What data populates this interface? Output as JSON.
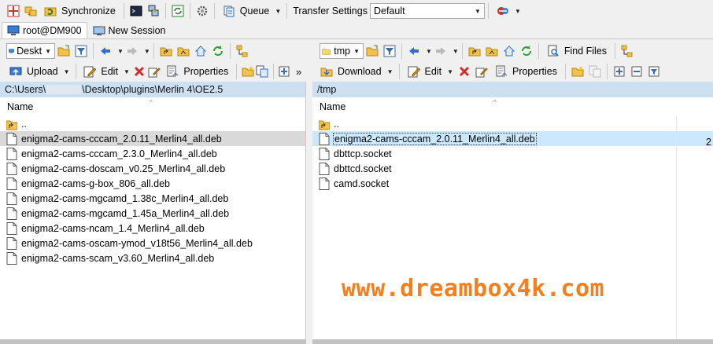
{
  "toolbar_top": {
    "synchronize_label": "Synchronize",
    "queue_label": "Queue",
    "transfer_settings_label": "Transfer Settings",
    "transfer_settings_value": "Default"
  },
  "tabs": [
    {
      "label": "root@DM900"
    },
    {
      "label": "New Session"
    }
  ],
  "left": {
    "drive_combo": "Deskt",
    "upload_label": "Upload",
    "edit_label": "Edit",
    "properties_label": "Properties",
    "path_prefix": "C:\\Users\\",
    "path_suffix": "\\Desktop\\plugins\\Merlin 4\\OE2.5",
    "column_name": "Name",
    "files": [
      {
        "name": ".."
      },
      {
        "name": "enigma2-cams-cccam_2.0.11_Merlin4_all.deb"
      },
      {
        "name": "enigma2-cams-cccam_2.3.0_Merlin4_all.deb"
      },
      {
        "name": "enigma2-cams-doscam_v0.25_Merlin4_all.deb"
      },
      {
        "name": "enigma2-cams-g-box_806_all.deb"
      },
      {
        "name": "enigma2-cams-mgcamd_1.38c_Merlin4_all.deb"
      },
      {
        "name": "enigma2-cams-mgcamd_1.45a_Merlin4_all.deb"
      },
      {
        "name": "enigma2-cams-ncam_1.4_Merlin4_all.deb"
      },
      {
        "name": "enigma2-cams-oscam-ymod_v18t56_Merlin4_all.deb"
      },
      {
        "name": "enigma2-cams-scam_v3.60_Merlin4_all.deb"
      }
    ]
  },
  "right": {
    "dir_combo": "tmp",
    "find_files_label": "Find Files",
    "download_label": "Download",
    "edit_label": "Edit",
    "properties_label": "Properties",
    "path": "/tmp",
    "column_name": "Name",
    "truncated_col_value": "2",
    "files": [
      {
        "name": ".."
      },
      {
        "name": "enigma2-cams-cccam_2.0.11_Merlin4_all.deb"
      },
      {
        "name": "dbttcp.socket"
      },
      {
        "name": "dbttcd.socket"
      },
      {
        "name": "camd.socket"
      }
    ]
  },
  "watermark": "www.dreambox4k.com",
  "colors": {
    "accent": "#f97e1a",
    "pathbar": "#cde0f2",
    "selection_blue": "#cce8ff"
  }
}
